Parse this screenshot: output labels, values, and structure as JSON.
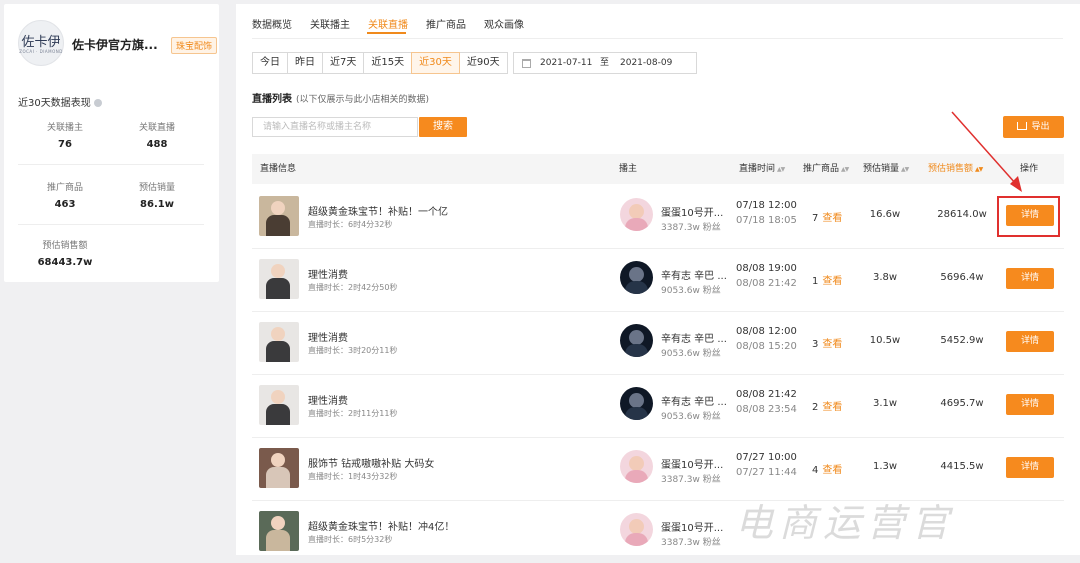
{
  "shop": {
    "logo_text": "佐卡伊",
    "logo_subtext": "ZOCAI · DIAMOND",
    "name": "佐卡伊官方旗...",
    "tag": "珠宝配饰"
  },
  "overview": {
    "title": "近30天数据表现",
    "stats": [
      {
        "label": "关联播主",
        "value": "76"
      },
      {
        "label": "关联直播",
        "value": "488"
      },
      {
        "label": "推广商品",
        "value": "463"
      },
      {
        "label": "预估销量",
        "value": "86.1w"
      },
      {
        "label": "预估销售额",
        "value": "68443.7w"
      }
    ]
  },
  "tabs": [
    "数据概览",
    "关联播主",
    "关联直播",
    "推广商品",
    "观众画像"
  ],
  "active_tab": "关联直播",
  "ranges": [
    "今日",
    "昨日",
    "近7天",
    "近15天",
    "近30天",
    "近90天"
  ],
  "active_range": "近30天",
  "date_range": {
    "start": "2021-07-11",
    "sep": "至",
    "end": "2021-08-09"
  },
  "list": {
    "title": "直播列表",
    "note": "(以下仅展示与此小店相关的数据)",
    "search_placeholder": "请输入直播名称或播主名称",
    "search_label": "搜索",
    "export_label": "导出"
  },
  "columns": {
    "info": "直播信息",
    "anchor": "播主",
    "time": "直播时间",
    "products": "推广商品",
    "sales": "预估销量",
    "gmv": "预估销售额",
    "action": "操作"
  },
  "rows": [
    {
      "title": "超级黄金珠宝节！补贴！一个亿",
      "duration": "直播时长：6时4分32秒",
      "anchor": "蛋蛋10号开...",
      "fans": "3387.3w 粉丝",
      "start": "07/18 12:00",
      "end": "07/18 18:05",
      "products": "7",
      "view": "查看",
      "sales": "16.6w",
      "gmv": "28614.0w",
      "detail": "详情"
    },
    {
      "title": "理性消费",
      "duration": "直播时长：2时42分50秒",
      "anchor": "辛有志 辛巴 ...",
      "fans": "9053.6w 粉丝",
      "start": "08/08 19:00",
      "end": "08/08 21:42",
      "products": "1",
      "view": "查看",
      "sales": "3.8w",
      "gmv": "5696.4w",
      "detail": "详情"
    },
    {
      "title": "理性消费",
      "duration": "直播时长：3时20分11秒",
      "anchor": "辛有志 辛巴 ...",
      "fans": "9053.6w 粉丝",
      "start": "08/08 12:00",
      "end": "08/08 15:20",
      "products": "3",
      "view": "查看",
      "sales": "10.5w",
      "gmv": "5452.9w",
      "detail": "详情"
    },
    {
      "title": "理性消费",
      "duration": "直播时长：2时11分11秒",
      "anchor": "辛有志 辛巴 ...",
      "fans": "9053.6w 粉丝",
      "start": "08/08 21:42",
      "end": "08/08 23:54",
      "products": "2",
      "view": "查看",
      "sales": "3.1w",
      "gmv": "4695.7w",
      "detail": "详情"
    },
    {
      "title": "服饰节 钻戒嗷嗷补贴 大码女",
      "duration": "直播时长：1时43分32秒",
      "anchor": "蛋蛋10号开...",
      "fans": "3387.3w 粉丝",
      "start": "07/27 10:00",
      "end": "07/27 11:44",
      "products": "4",
      "view": "查看",
      "sales": "1.3w",
      "gmv": "4415.5w",
      "detail": "详情"
    },
    {
      "title": "超级黄金珠宝节！补贴！冲4亿！",
      "duration": "直播时长：6时5分32秒",
      "anchor": "蛋蛋10号开...",
      "fans": "3387.3w 粉丝",
      "start": "",
      "end": "",
      "products": "",
      "view": "",
      "sales": "",
      "gmv": "",
      "detail": ""
    }
  ],
  "watermark": "电商运营官",
  "colors": {
    "accent": "#f68a1e",
    "highlight": "#e0302e"
  }
}
